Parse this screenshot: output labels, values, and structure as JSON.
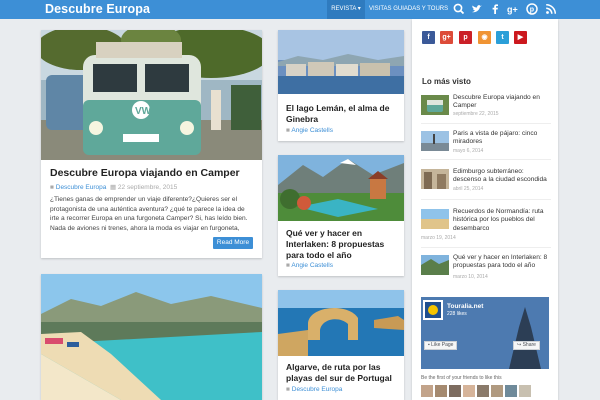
{
  "header": {
    "logo": "Descubre Europa",
    "nav": [
      {
        "label": "REVISTA ▾"
      },
      {
        "label": "VISITAS GUIADAS Y TOURS"
      }
    ],
    "icons": [
      "search-icon",
      "twitter-icon",
      "facebook-icon",
      "google-plus-icon",
      "pinterest-icon",
      "rss-icon"
    ],
    "accent": "#3d8fd6"
  },
  "posts": {
    "camper": {
      "title": "Descubre Europa viajando en Camper",
      "author": "Descubre Europa",
      "date": "22 septiembre, 2015",
      "excerpt": "¿Tienes ganas de emprender un viaje diferente?¿Quieres ser el protagonista de una auténtica aventura? ¿qué te parece la idea de irte a recorrer Europa en una furgoneta Camper? Si, has leído bien. Nada de aviones ni trenes, ahora la moda es viajar en furgoneta,",
      "read_more": "Read More"
    },
    "leman": {
      "title": "El lago Lemán, el alma de Ginebra",
      "author": "Angie Castells"
    },
    "interlaken": {
      "title": "Qué ver y hacer en Interlaken: 8 propuestas para todo el año",
      "author": "Angie Castells"
    },
    "algarve": {
      "title": "Algarve, de ruta por las playas del sur de Portugal",
      "author": "Descubre Europa"
    }
  },
  "sidebar": {
    "social": [
      {
        "icon": "facebook-icon",
        "glyph": "f",
        "color": "#3b5998"
      },
      {
        "icon": "google-plus-icon",
        "glyph": "g+",
        "color": "#dd4b39"
      },
      {
        "icon": "pinterest-icon",
        "glyph": "p",
        "color": "#cb2027"
      },
      {
        "icon": "rss-icon",
        "glyph": "◉",
        "color": "#f09433"
      },
      {
        "icon": "twitter-icon",
        "glyph": "t",
        "color": "#2b9fd8"
      },
      {
        "icon": "youtube-icon",
        "glyph": "▶",
        "color": "#cc181e"
      }
    ],
    "heading": "Lo más visto",
    "popular": [
      {
        "title": "Descubre Europa viajando en Camper",
        "date": "septiembre 22, 2015"
      },
      {
        "title": "Paris a vista de pájaro: cinco miradores",
        "date": "mayo 6, 2014"
      },
      {
        "title": "Edimburgo subterráneo: descenso a la ciudad escondida",
        "date": "abril 25, 2014"
      },
      {
        "title": "Recuerdos de Normandía: ruta histórica por los pueblos del desembarco",
        "date": "marzo 19, 2014"
      },
      {
        "title": "Qué ver y hacer en Interlaken: 8 propuestas para todo el año",
        "date": "marzo 10, 2014"
      }
    ],
    "fb": {
      "name": "Touralia.net",
      "likes": "228 likes",
      "like_btn": "Like Page",
      "share_btn": "Share",
      "footer": "Be the first of your friends to like this"
    }
  }
}
